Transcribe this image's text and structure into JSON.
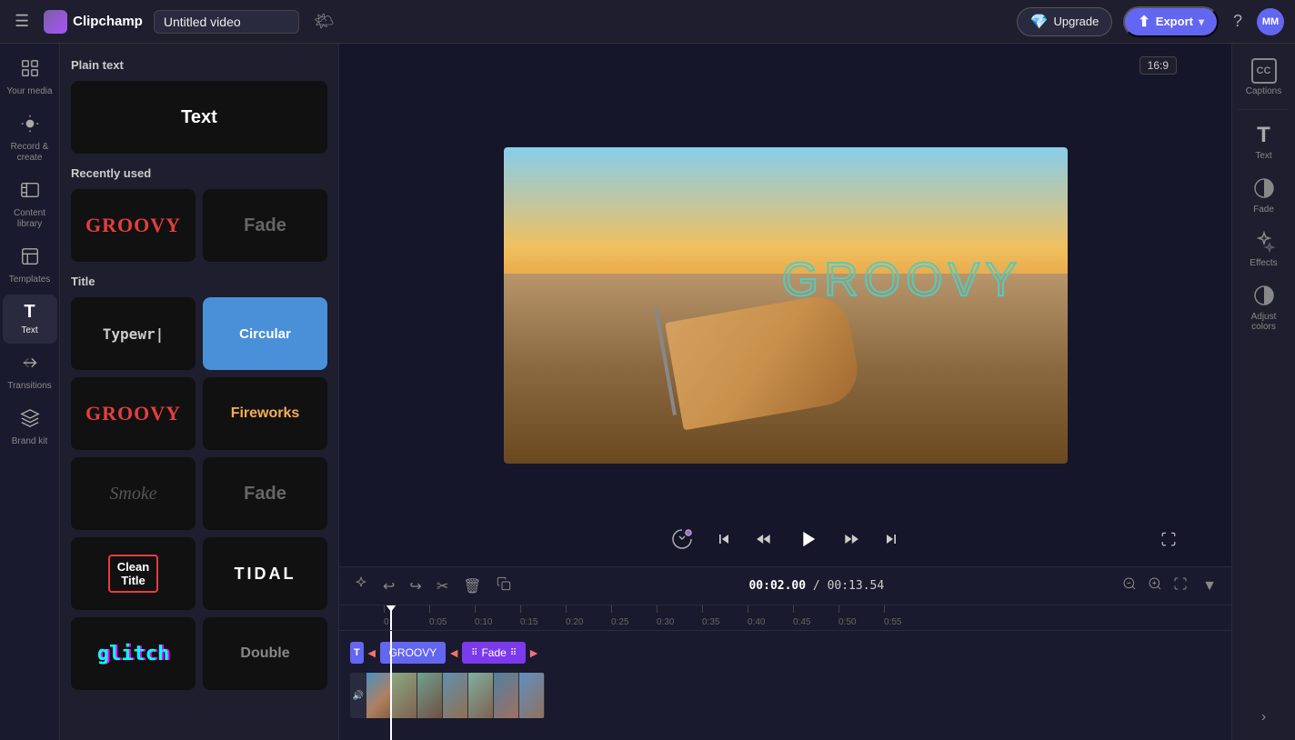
{
  "topbar": {
    "hamburger": "☰",
    "logo_icon": "🟣",
    "logo_text": "Clipchamp",
    "video_title": "Untitled video",
    "weather_icon": "🌤",
    "upgrade_label": "Upgrade",
    "upgrade_gem": "💎",
    "export_label": "Export",
    "export_icon": "⬆",
    "export_dropdown": "▾",
    "help_icon": "?",
    "avatar": "MM"
  },
  "sidebar": {
    "items": [
      {
        "id": "your-media",
        "icon": "🖼",
        "label": "Your media"
      },
      {
        "id": "record",
        "icon": "⏺",
        "label": "Record &\ncreate"
      },
      {
        "id": "content-library",
        "icon": "📚",
        "label": "Content library"
      },
      {
        "id": "templates",
        "icon": "⬛",
        "label": "Templates"
      },
      {
        "id": "text",
        "icon": "T",
        "label": "Text",
        "active": true
      },
      {
        "id": "transitions",
        "icon": "↔",
        "label": "Transitions"
      },
      {
        "id": "brand-kit",
        "icon": "🎨",
        "label": "Brand kit"
      }
    ]
  },
  "text_panel": {
    "plain_text_title": "Plain text",
    "recently_used_title": "Recently used",
    "title_section": "Title",
    "cards": {
      "plain_text": "Text",
      "groovy_recent": "GROOVY",
      "fade_recent": "Fade",
      "typewriter": "Typewr|",
      "circular": "Circular",
      "groovy_title": "GROOVY",
      "fireworks": "Fireworks",
      "smoke": "Smoke",
      "fade_title": "Fade",
      "clean_title": "Clean\nTitle",
      "tidal": "TIDAL",
      "double": "Double",
      "glitch": "glitch"
    }
  },
  "preview": {
    "ratio": "16:9",
    "groovy_text": "GROOVY",
    "time_current": "00:02.00",
    "time_total": "00:13.54"
  },
  "timeline": {
    "time_display": "00:02.00 / 00:13.54",
    "time_current": "00:02.00",
    "time_separator": "/",
    "time_total": "00:13.54",
    "ruler_marks": [
      "0",
      "0:05",
      "0:10",
      "0:15",
      "0:20",
      "0:25",
      "0:30",
      "0:35",
      "0:40",
      "0:45",
      "0:50",
      "0:55"
    ],
    "groovy_clip": "GROOVY",
    "fade_clip": "Fade"
  },
  "right_sidebar": {
    "captions_icon": "CC",
    "captions_label": "Captions",
    "text_icon": "T",
    "text_label": "Text",
    "fade_icon": "◑",
    "fade_label": "Fade",
    "effects_icon": "✦",
    "effects_label": "Effects",
    "adjust_icon": "◑",
    "adjust_label": "Adjust colors"
  }
}
